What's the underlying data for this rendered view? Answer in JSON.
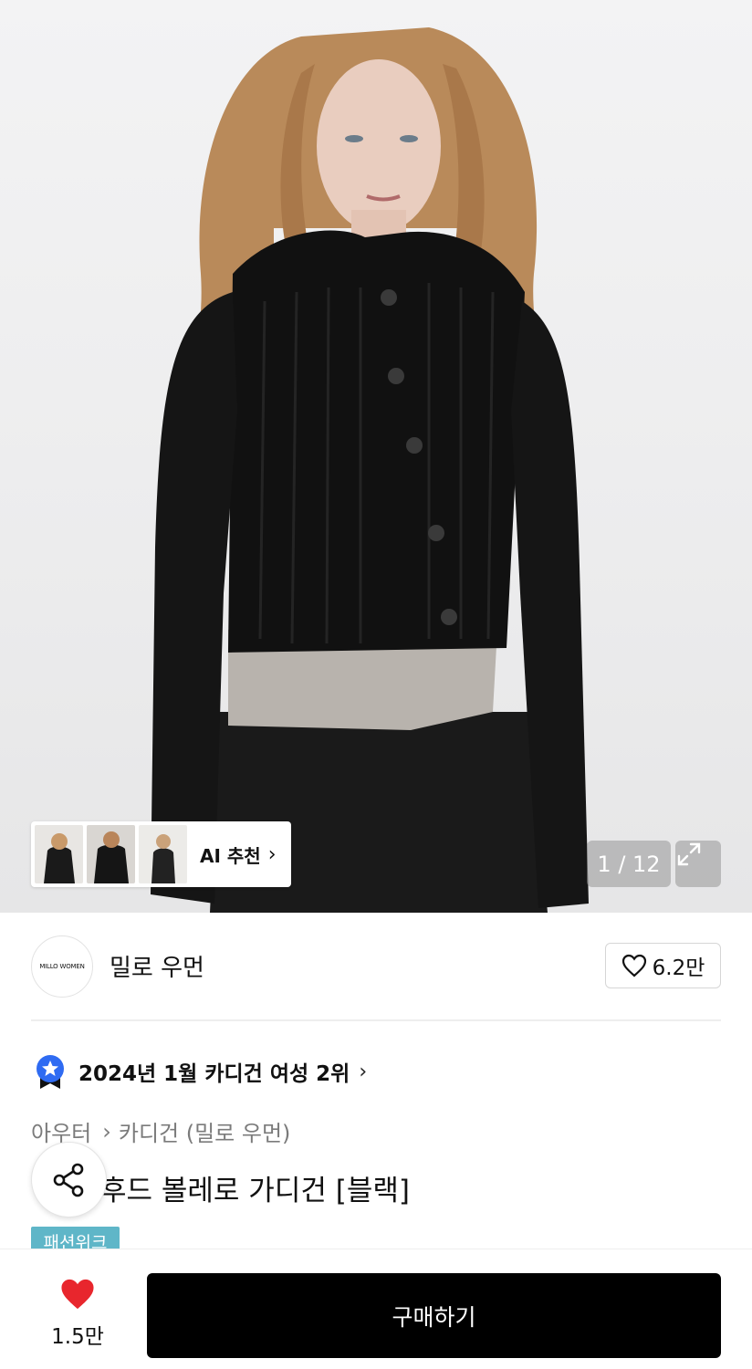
{
  "gallery": {
    "ai_label": "AI 추천",
    "ai_chevron": "›",
    "counter": "1 / 12",
    "thumbnails": [
      "ai-thumbnail-1",
      "ai-thumbnail-2",
      "ai-thumbnail-3"
    ],
    "expand_icon": "expand-icon"
  },
  "brand": {
    "logo_text": "MILLO WOMEN",
    "name": "밀로 우먼",
    "likes": "6.2만",
    "heart_icon": "heart-outline-icon"
  },
  "ranking": {
    "badge_icon": "star-medal-icon",
    "text": "2024년 1월 카디건 여성 2위",
    "chevron": "›"
  },
  "breadcrumb": {
    "category": "아우터",
    "separator": "›",
    "subcategory": "카디건 (밀로 우먼)"
  },
  "product": {
    "title": "후드 볼레로 가디건 [블랙]",
    "tag": "패션위크",
    "share_icon": "share-icon"
  },
  "bottom_bar": {
    "wish_count": "1.5만",
    "wish_icon": "heart-filled-icon",
    "buy_label": "구매하기"
  },
  "colors": {
    "accent_heart": "#e8262d",
    "tag_bg": "#5fb6c8",
    "buy_bg": "#000000",
    "badge_blue": "#2f6bf2"
  }
}
